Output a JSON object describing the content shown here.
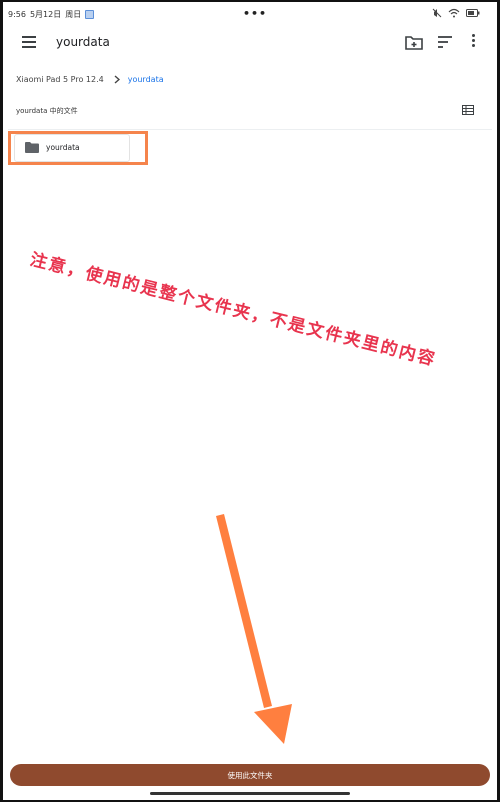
{
  "status_bar": {
    "time": "9:56",
    "date": "5月12日",
    "weekday": "周日",
    "sim_icon": "sim-card-icon",
    "dots": "•••",
    "mute_icon": "mute-icon",
    "wifi_icon": "wifi-icon"
  },
  "app_bar": {
    "title": "yourdata",
    "menu_icon": "hamburger-menu-icon",
    "new_folder_icon": "new-folder-icon",
    "sort_icon": "sort-icon",
    "more_icon": "more-vert-icon"
  },
  "breadcrumb": {
    "root": "Xiaomi Pad 5 Pro 12.4",
    "separator_icon": "chevron-right-icon",
    "current": "yourdata"
  },
  "section": {
    "label": "yourdata 中的文件",
    "view_toggle_icon": "list-view-icon"
  },
  "items": [
    {
      "name": "yourdata",
      "type": "folder",
      "icon": "folder-icon"
    }
  ],
  "annotation": {
    "text": "注意，使用的是整个文件夹，不是文件夹里的内容",
    "color": "#e8344e"
  },
  "action": {
    "use_folder_label": "使用此文件夹",
    "color": "#8f4a2e"
  },
  "colors": {
    "highlight": "#f5844c",
    "arrow": "#ff7f3f",
    "accent": "#1a73e8"
  }
}
